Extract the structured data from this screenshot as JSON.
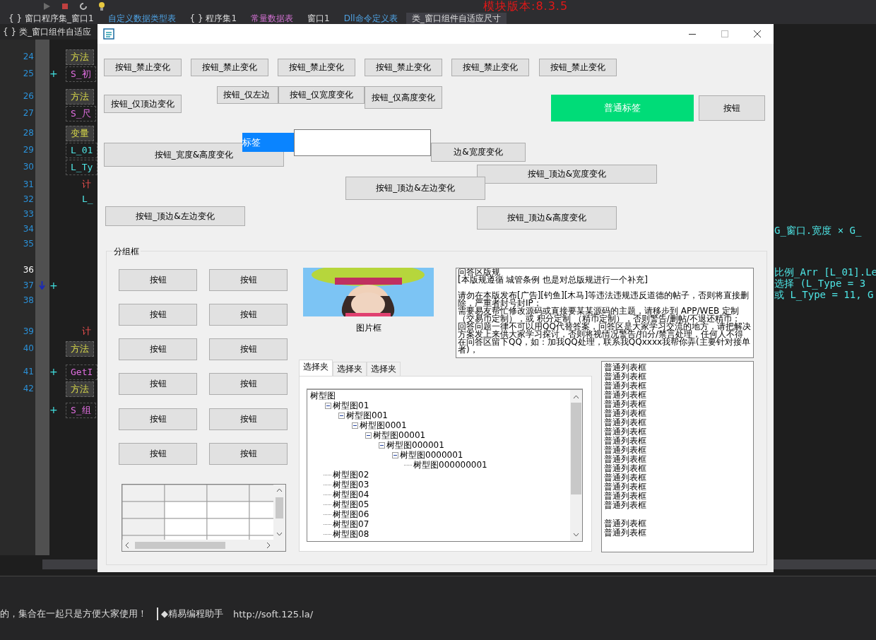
{
  "ide": {
    "toolbar": {
      "version": "模块版本:8.3.5"
    },
    "tabs": [
      {
        "label": "{ } 窗口程序集_窗口1",
        "selected": false,
        "kind": "module"
      },
      {
        "label": "自定义数据类型表",
        "selected": false,
        "kind": "table"
      },
      {
        "label": "{ } 程序集1",
        "selected": false,
        "kind": "module"
      },
      {
        "label": "常量数据表",
        "selected": false,
        "kind": "constant"
      },
      {
        "label": "窗口1",
        "selected": false,
        "kind": "module"
      },
      {
        "label": "Dll命令定义表",
        "selected": false,
        "kind": "table"
      },
      {
        "label": "类_窗口组件自适应尺寸",
        "selected": true,
        "kind": "module"
      }
    ],
    "breadcrumb": "{ } 类_窗口组件自适应",
    "code_lines": [
      {
        "number": "24",
        "kind": "header",
        "text": "方法"
      },
      {
        "number": "25",
        "kind": "name",
        "text": "S_初",
        "gutter": "+"
      },
      {
        "number": "26",
        "kind": "header",
        "text": "方法"
      },
      {
        "number": "27",
        "kind": "name",
        "text": "S_尺"
      },
      {
        "number": "28",
        "kind": "header",
        "text": "变量"
      },
      {
        "number": "29",
        "kind": "var",
        "text": "L_01"
      },
      {
        "number": "30",
        "kind": "var",
        "text": "L_Ty"
      },
      {
        "number": "31",
        "kind": "loop",
        "text": "计"
      },
      {
        "number": "32",
        "kind": "plain",
        "text": "L_"
      },
      {
        "number": "33",
        "kind": "plain"
      },
      {
        "number": "34",
        "kind": "plain"
      },
      {
        "number": "35",
        "kind": "plain"
      },
      {
        "number": "36",
        "kind": "plain",
        "current": true
      },
      {
        "number": "37",
        "kind": "plain",
        "gutter": "+",
        "arrow": true
      },
      {
        "number": "38",
        "kind": "plain"
      },
      {
        "number": "39",
        "kind": "loop",
        "text": "计"
      },
      {
        "number": "40",
        "kind": "header",
        "text": "方法"
      },
      {
        "number": "41",
        "kind": "name",
        "text": "GetI",
        "gutter": "+"
      },
      {
        "number": "42",
        "kind": "header",
        "text": "方法"
      },
      {
        "kind": "name",
        "text": "S_组",
        "gutter": "+"
      }
    ],
    "code_right": [
      {
        "text": "G_窗口.宽度 × G_"
      },
      {
        "text": "比例_Arr [L_01].Le"
      },
      {
        "text": "选择 (L_Type = 3"
      },
      {
        "text": "或 L_Type = 11, G"
      }
    ],
    "output": [
      {
        "text": "的，集合在一起只是方便大家使用！",
        "tool": "◆精易编程助手",
        "url": "http://soft.125.la/"
      }
    ]
  },
  "window": {
    "buttons": [
      {
        "label": "按钮_禁止变化"
      },
      {
        "label": "按钮_禁止变化"
      },
      {
        "label": "按钮_禁止变化"
      },
      {
        "label": "按钮_禁止变化"
      },
      {
        "label": "按钮_禁止变化"
      },
      {
        "label": "按钮_禁止变化"
      },
      {
        "label": "按钮_仅顶边变化"
      },
      {
        "label": "按钮_仅左边"
      },
      {
        "label": "按钮_仅宽度变化"
      },
      {
        "label": "按钮_仅高度变化"
      },
      {
        "label": "按钮"
      },
      {
        "label": "按钮_宽度&高度变化"
      },
      {
        "label": "边&宽度变化"
      },
      {
        "label": "按钮_顶边&宽度变化"
      },
      {
        "label": "按钮_顶边&左边变化"
      },
      {
        "label": "按钮_顶边&左边变化"
      },
      {
        "label": "按钮_顶边&高度变化"
      }
    ],
    "green_label": "普通标签",
    "blue_label": "标签",
    "group": {
      "title": "分组框",
      "buttons": [
        "按钮",
        "按钮",
        "按钮",
        "按钮",
        "按钮",
        "按钮",
        "按钮",
        "按钮",
        "按钮",
        "按钮",
        "按钮",
        "按钮"
      ],
      "picture_caption": "图片框",
      "text_box": [
        [
          "问答区版规",
          "[本版规遵循 城管条例 也是对总版规进行一个补充]"
        ],
        [
          "请勿在本版发布[广告][钓鱼][木马]等违法违规违反道德的帖子，否则将直接删除，严重者封号封IP；",
          "需要易友帮忙修改源码或直接要某某源码的主题，请移步到 APP/WEB 定制（交易币定制），或 积分定制 （精币定制），否则警告/删帖/不退还精币；",
          "回答问题一律不可以用QQ代替答案，问答区是大家学习交流的地方，请把解决方案发上来供大家学习探讨，否则将视情况警告/扣分/禁言处理，任何人不得在问答区留下QQ，如：加我QQ处理，联系我QQxxxx我帮你弄(主要针对接单者)，"
        ]
      ],
      "tabs": [
        {
          "label": "选择夹",
          "selected": true
        },
        {
          "label": "选择夹",
          "selected": false
        },
        {
          "label": "选择夹",
          "selected": false
        }
      ],
      "tree": [
        {
          "label": "树型图",
          "children": [
            {
              "label": "树型图01",
              "expanded": true,
              "children": [
                {
                  "label": "树型图001",
                  "expanded": true,
                  "children": [
                    {
                      "label": "树型图0001",
                      "expanded": true,
                      "children": [
                        {
                          "label": "树型图00001",
                          "expanded": true,
                          "children": [
                            {
                              "label": "树型图000001",
                              "expanded": true,
                              "children": [
                                {
                                  "label": "树型图0000001",
                                  "expanded": true,
                                  "children": [
                                    {
                                      "label": "树型图000000001"
                                    }
                                  ]
                                }
                              ]
                            }
                          ]
                        }
                      ]
                    }
                  ]
                }
              ]
            },
            {
              "label": "树型图02"
            },
            {
              "label": "树型图03"
            },
            {
              "label": "树型图04"
            },
            {
              "label": "树型图05"
            },
            {
              "label": "树型图06"
            },
            {
              "label": "树型图07"
            },
            {
              "label": "树型图08"
            }
          ]
        }
      ],
      "list_groups": [
        [
          "普通列表框",
          "普通列表框",
          "普通列表框",
          "普通列表框",
          "普通列表框",
          "普通列表框",
          "普通列表框",
          "普通列表框",
          "普通列表框",
          "普通列表框",
          "普通列表框",
          "普通列表框",
          "普通列表框",
          "普通列表框",
          "普通列表框",
          "普通列表框"
        ],
        [
          "普通列表框",
          "普通列表框"
        ]
      ]
    }
  }
}
